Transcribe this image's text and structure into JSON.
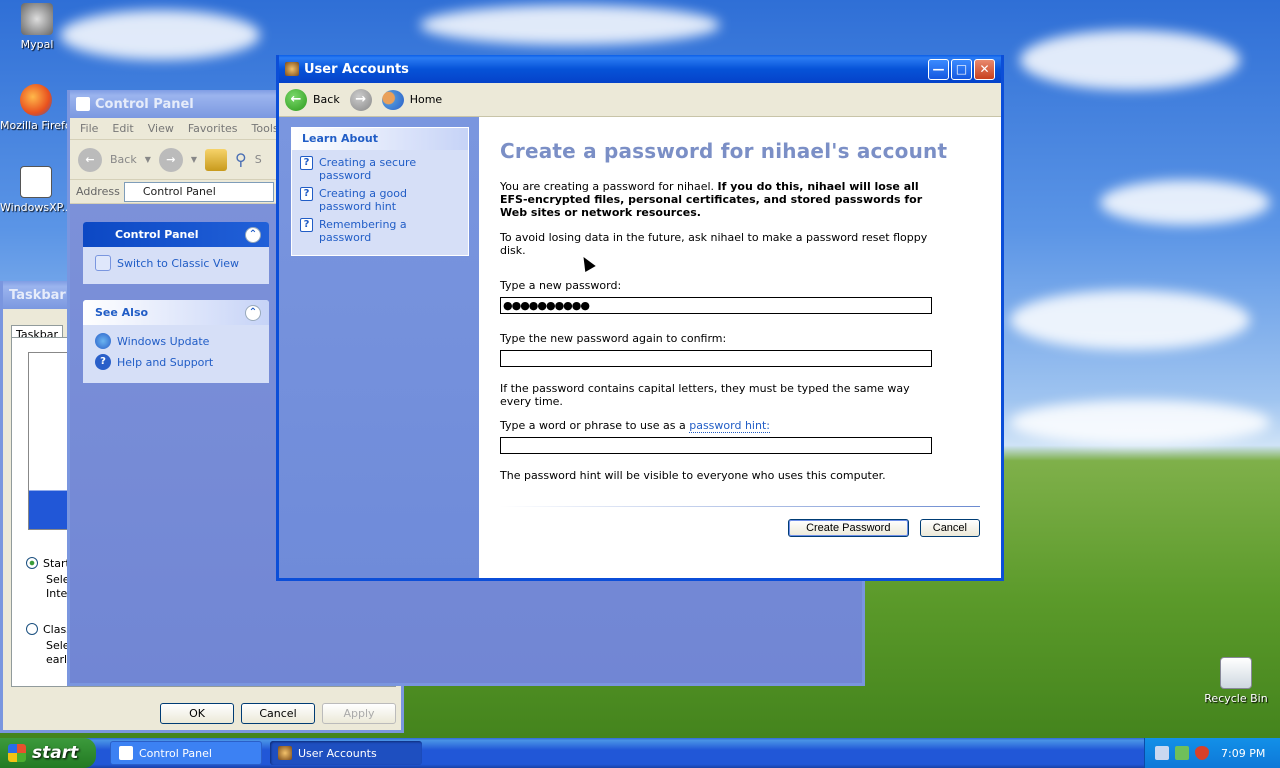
{
  "desktop": {
    "icons": [
      {
        "label": "Mypal"
      },
      {
        "label": "Mozilla Firefox"
      },
      {
        "label": "WindowsXP..."
      },
      {
        "label": "Recycle Bin"
      }
    ]
  },
  "control_panel": {
    "title": "Control Panel",
    "menu": [
      "File",
      "Edit",
      "View",
      "Favorites",
      "Tools"
    ],
    "toolbar_back": "Back",
    "toolbar_search_partial": "S",
    "address_label": "Address",
    "address_value": "Control Panel",
    "panel_title": "Control Panel",
    "switch_view": "Switch to Classic View",
    "see_also_title": "See Also",
    "see_also_items": [
      "Windows Update",
      "Help and Support"
    ]
  },
  "taskbar_dialog": {
    "title_partial": "Taskbar a",
    "tab": "Taskbar",
    "option1": "Start",
    "option1_desc1": "Selec",
    "option1_desc2": "Interr",
    "option2": "Class",
    "option2_desc1": "Selec",
    "option2_desc2": "earlie",
    "ok": "OK",
    "cancel": "Cancel",
    "apply": "Apply"
  },
  "user_accounts": {
    "title": "User Accounts",
    "nav_back": "Back",
    "nav_home": "Home",
    "learn_about_title": "Learn About",
    "learn_items": [
      "Creating a secure password",
      "Creating a good password hint",
      "Remembering a password"
    ],
    "heading": "Create a password for nihael's account",
    "intro_normal": "You are creating a password for nihael. ",
    "intro_bold": "If you do this, nihael will lose all EFS-encrypted files, personal certificates, and stored passwords for Web sites or network resources.",
    "avoid_text": "To avoid losing data in the future, ask nihael to make a password reset floppy disk.",
    "new_password_label": "Type a new password:",
    "new_password_value": "●●●●●●●●●●",
    "confirm_label": "Type the new password again to confirm:",
    "confirm_value": "",
    "caps_text": "If the password contains capital letters, they must be typed the same way every time.",
    "hint_label_prefix": "Type a word or phrase to use as a ",
    "hint_link": "password hint:",
    "hint_value": "",
    "hint_visible_text": "The password hint will be visible to everyone who uses this computer.",
    "create_button": "Create Password",
    "cancel_button": "Cancel"
  },
  "taskbar": {
    "start": "start",
    "tasks": [
      "Control Panel",
      "User Accounts"
    ],
    "clock": "7:09 PM"
  }
}
